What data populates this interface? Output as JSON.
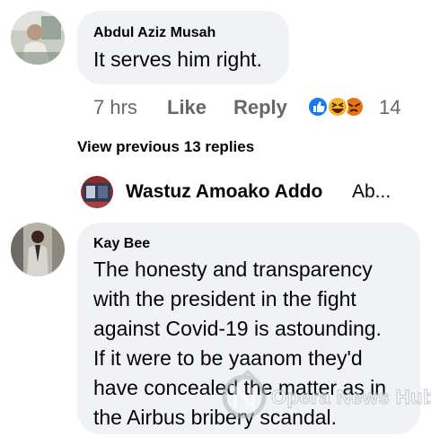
{
  "comment1": {
    "author": "Abdul Aziz Musah",
    "text": "It serves him right.",
    "time": "7 hrs",
    "like_label": "Like",
    "reply_label": "Reply",
    "reaction_icons": [
      "like-icon",
      "haha-icon",
      "angry-icon"
    ],
    "reaction_count": "14"
  },
  "replies": {
    "view_previous": "View previous 13 replies",
    "latest_reply_author": "Wastuz Amoako Addo",
    "latest_reply_snippet": "Ab..."
  },
  "comment2": {
    "author": "Kay Bee",
    "lines": [
      "The honesty and transparency",
      "with the president in the fight",
      "against Covid-19 is astounding.",
      "If it were to be yaanom they'd",
      "have concealed the matter as in",
      "the Airbus bribery scandal."
    ]
  },
  "watermark": {
    "text": "Opera News Hub"
  },
  "colors": {
    "bubble": "#f0f2f5",
    "meta": "#65676b",
    "like_blue": "#1877f2",
    "haha_yellow": "#f7b125",
    "angry_orange": "#e9710f"
  }
}
